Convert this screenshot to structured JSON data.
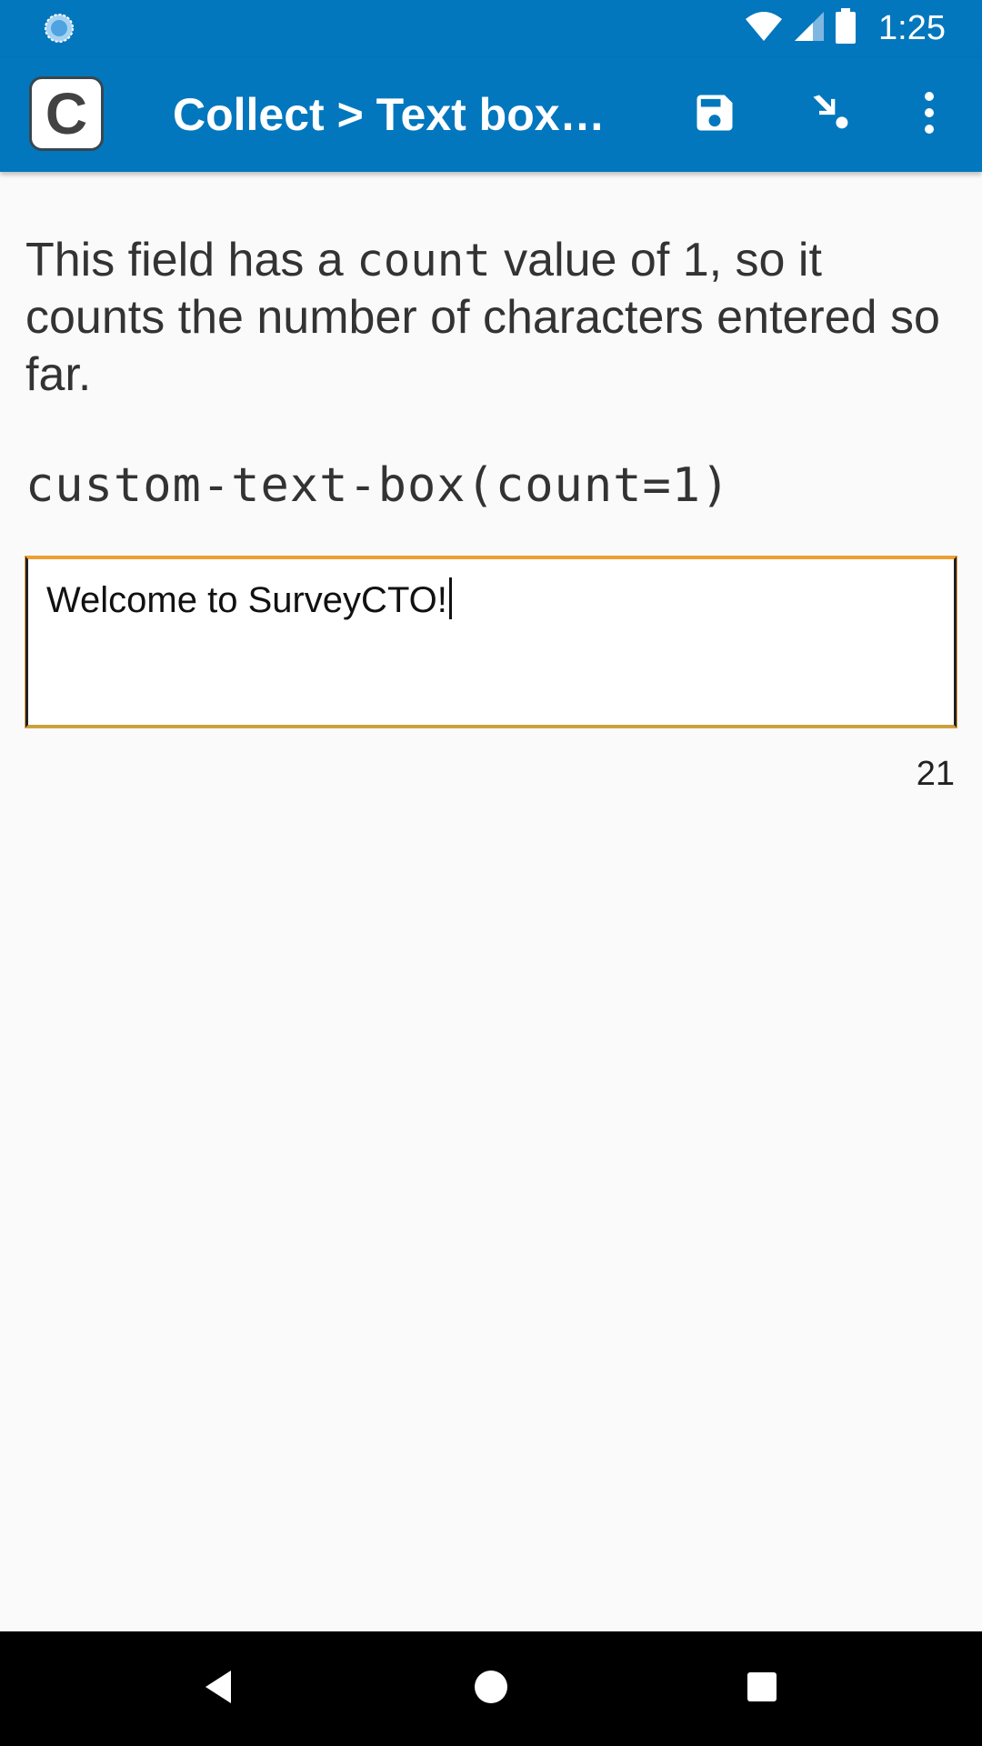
{
  "status_bar": {
    "time": "1:25",
    "icons": [
      "sync-icon",
      "wifi-icon",
      "cellular-signal-icon",
      "battery-icon"
    ]
  },
  "app_bar": {
    "logo_letter": "C",
    "title": "Collect > Text box…",
    "actions": [
      "save-icon",
      "jump-icon",
      "overflow-menu-icon"
    ]
  },
  "question": {
    "text_before": "This field has a ",
    "code_word": "count",
    "text_after": " value of 1, so it counts the number of characters entered so far.",
    "appearance": "custom-text-box(count=1)"
  },
  "text_box": {
    "value": "Welcome to SurveyCTO!",
    "char_count": "21"
  },
  "nav_bar": {
    "buttons": [
      "back-icon",
      "home-icon",
      "recents-icon"
    ]
  },
  "colors": {
    "primary": "#0277bd",
    "background": "#fafafa",
    "focus_accent": "#f0a030"
  }
}
